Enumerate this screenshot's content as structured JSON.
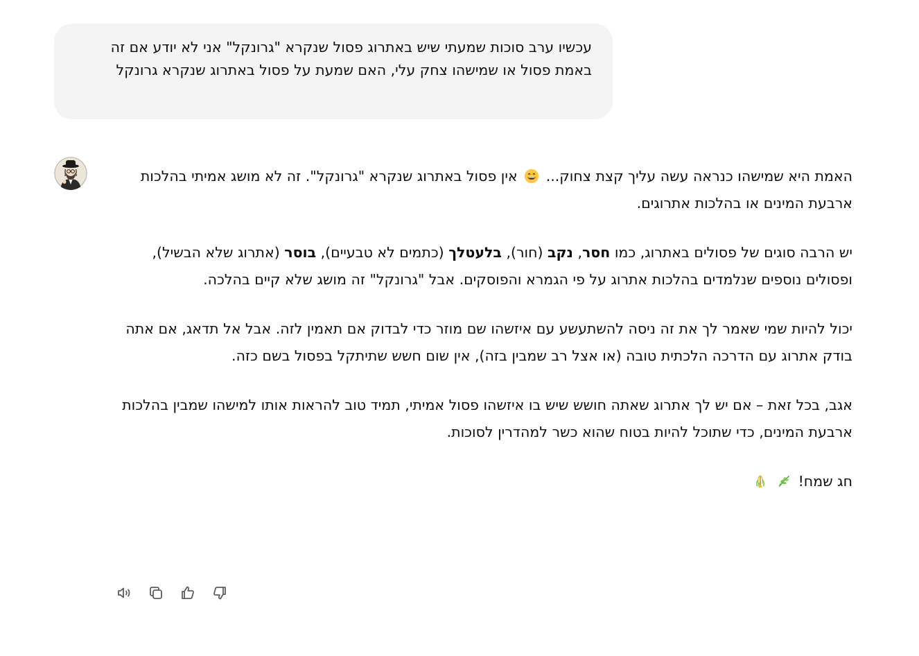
{
  "user_message": {
    "text": "עכשיו ערב סוכות שמעתי שיש באתרוג פסול שנקרא \"גרונקל\" אני לא יודע אם זה באמת פסול או שמישהו צחק עלי, האם שמעת על פסול באתרוג שנקרא גרונקל"
  },
  "assistant": {
    "avatar_icon": "assistant-avatar-icon",
    "p1": {
      "a": "האמת היא שמישהו כנראה עשה עליך קצת צחוק...",
      "emoji": "grinning-face-emoji",
      "b": "אין פסול באתרוג שנקרא \"גרונקל\". זה לא מושג אמיתי בהלכות ארבעת המינים או בהלכות אתרוגים."
    },
    "p2": {
      "a": "יש הרבה סוגים של פסולים באתרוג, כמו ",
      "t1": "חסר",
      "s1": ", ",
      "t2": "נקב",
      "c2": " (חור), ",
      "t3": "בלעטלך",
      "c3": " (כתמים לא טבעיים), ",
      "t4": "בוסר",
      "c4": " (אתרוג שלא הבשיל), ופסולים נוספים שנלמדים בהלכות אתרוג על פי הגמרא והפוסקים. אבל \"גרונקל\" זה מושג שלא קיים בהלכה."
    },
    "p3": "יכול להיות שמי שאמר לך את זה ניסה להשתעשע עם איזשהו שם מוזר כדי לבדוק אם תאמין לזה. אבל אל תדאג, אם אתה בודק אתרוג עם הדרכה הלכתית טובה (או אצל רב שמבין בזה), אין שום חשש שתיתקל בפסול בשם כזה.",
    "p4": "אגב, בכל זאת – אם יש לך אתרוג שאתה חושש שיש בו איזשהו פסול אמיתי, תמיד טוב להראות אותו למישהו שמבין בהלכות ארבעת המינים, כדי שתוכל להיות בטוח שהוא כשר למהדרין לסוכות.",
    "p5": {
      "text": "חג שמח!",
      "emoji1": "herb-emoji",
      "emoji2": "lulav-emoji"
    }
  },
  "actions": {
    "icons": [
      "read-aloud-icon",
      "copy-icon",
      "thumbs-up-icon",
      "thumbs-down-icon"
    ]
  },
  "colors": {
    "bubble_bg": "#f4f4f4",
    "text": "#0d0d0d",
    "icon": "#5d5d5d"
  }
}
